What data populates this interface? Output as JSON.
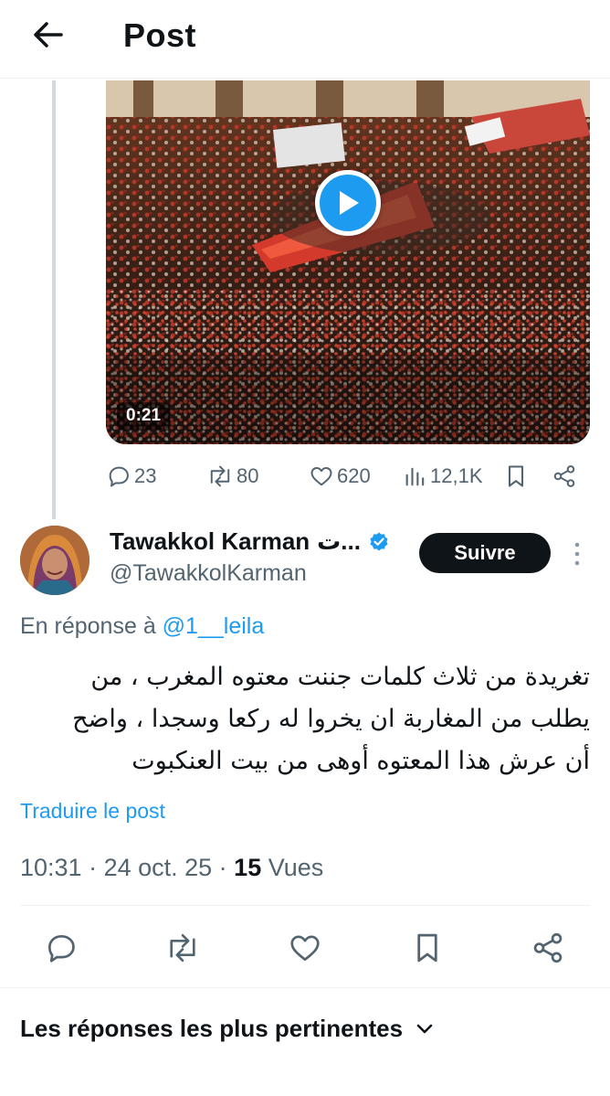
{
  "header": {
    "back_icon": "arrow-left-icon",
    "title": "Post"
  },
  "video": {
    "duration": "0:21",
    "play_icon": "play-icon"
  },
  "quoted_actions": {
    "replies": "23",
    "reposts": "80",
    "likes": "620",
    "views": "12,1K",
    "icons": [
      "reply-icon",
      "repost-icon",
      "like-icon",
      "views-icon",
      "bookmark-icon",
      "share-icon"
    ]
  },
  "author": {
    "name": "Tawakkol Karman",
    "name_suffix": "...ت",
    "handle": "@TawakkolKarman",
    "verified_icon": "verified-badge-icon",
    "follow_label": "Suivre",
    "more_icon": "more-vertical-icon"
  },
  "reply_to": {
    "prefix": "En réponse à",
    "mention": "@1__leila"
  },
  "tweet": {
    "text_lines": [
      "تغريدة من ثلاث كلمات جننت معتوه المغرب ، من",
      "يطلب من المغاربة ان يخروا له ركعا وسجدا ، واضح",
      "أن عرش هذا المعتوه أوهى من بيت العنكبوت"
    ],
    "translate_label": "Traduire le post"
  },
  "meta": {
    "time": "10:31",
    "sep1": " · ",
    "date": "24 oct. 25",
    "sep2": " · ",
    "views_count": "15",
    "views_label": " Vues"
  },
  "bottom_actions": {
    "icons": [
      "reply-icon",
      "repost-icon",
      "like-icon",
      "bookmark-icon",
      "share-icon"
    ]
  },
  "replies_sort": {
    "label": "Les réponses les plus pertinentes",
    "icon": "chevron-down-icon"
  },
  "colors": {
    "accent": "#1d9bf0",
    "text": "#0f1419",
    "muted": "#536471",
    "divider": "#eff3f4",
    "follow_bg": "#0f1419"
  }
}
